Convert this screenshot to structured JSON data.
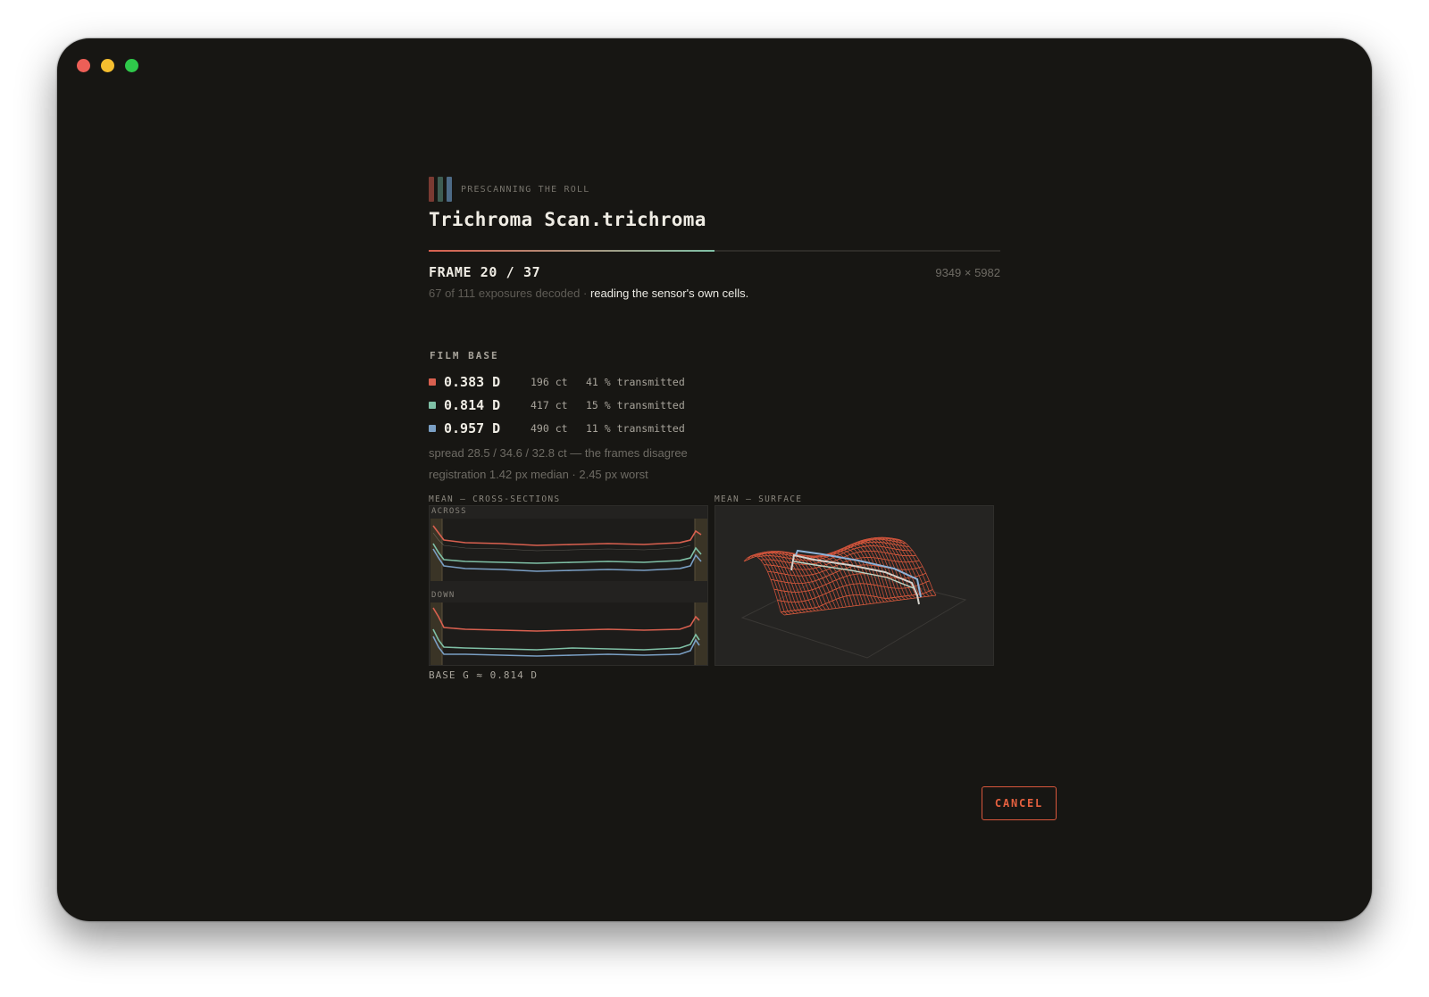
{
  "colors": {
    "red": "#d9604f",
    "green": "#7fc0a6",
    "blue": "#7a9fc4",
    "accent": "#e4603f",
    "window_bg": "#171613"
  },
  "header": {
    "kicker": "PRESCANNING THE ROLL",
    "title": "Trichroma Scan.trichroma"
  },
  "progress": {
    "fraction": 0.5,
    "frame_label": "FRAME 20 / 37",
    "dimensions": "9349 × 5982",
    "exposures": "67 of 111 exposures decoded ·",
    "activity": "reading the sensor's own cells."
  },
  "film_base": {
    "label": "FILM BASE",
    "channels": [
      {
        "channel": "red",
        "density": "0.383 D",
        "counts": "196 ct",
        "transmitted": "41 % transmitted"
      },
      {
        "channel": "green",
        "density": "0.814 D",
        "counts": "417 ct",
        "transmitted": "15 % transmitted"
      },
      {
        "channel": "blue",
        "density": "0.957 D",
        "counts": "490 ct",
        "transmitted": "11 % transmitted"
      }
    ],
    "spread": "spread 28.5 / 34.6 / 32.8 ct — the frames disagree",
    "registration": "registration 1.42 px median · 2.45 px worst"
  },
  "charts": {
    "cross_sections_label": "MEAN — CROSS-SECTIONS",
    "surface_label": "MEAN — SURFACE",
    "across_label": "ACROSS",
    "down_label": "DOWN",
    "base_g": "BASE G ≈ 0.814 D"
  },
  "actions": {
    "cancel": "CANCEL"
  }
}
